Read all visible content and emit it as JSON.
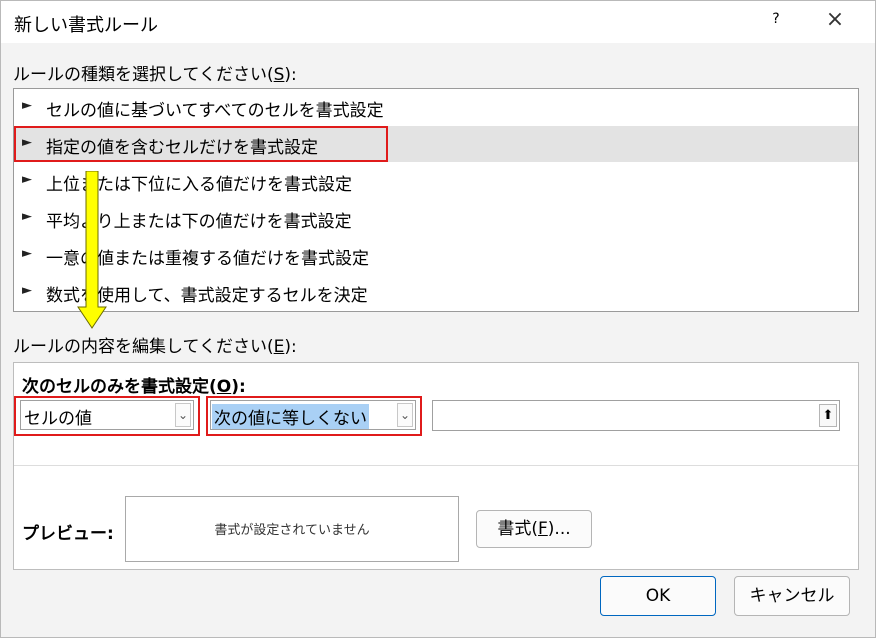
{
  "window": {
    "title": "新しい書式ルール",
    "help": "?",
    "close": "×"
  },
  "rule_type": {
    "label_pre": "ルールの種類を選択してください(",
    "label_key": "S",
    "label_post": "):",
    "items": [
      {
        "arrow": "►",
        "label": "セルの値に基づいてすべてのセルを書式設定"
      },
      {
        "arrow": "►",
        "label": "指定の値を含むセルだけを書式設定"
      },
      {
        "arrow": "►",
        "label": "上位または下位に入る値だけを書式設定"
      },
      {
        "arrow": "►",
        "label": "平均より上または下の値だけを書式設定"
      },
      {
        "arrow": "►",
        "label": "一意の値または重複する値だけを書式設定"
      },
      {
        "arrow": "►",
        "label": "数式を使用して、書式設定するセルを決定"
      }
    ],
    "selected_index": 1
  },
  "edit": {
    "label_pre": "ルールの内容を編集してください(",
    "label_key": "E",
    "label_post": "):",
    "heading_pre": "次のセルのみを書式設定(",
    "heading_key": "O",
    "heading_post": "):",
    "combo1_value": "セルの値",
    "combo2_value": "次の値に等しくない",
    "value_input": ""
  },
  "preview": {
    "label": "プレビュー:",
    "text": "書式が設定されていません",
    "format_button_pre": "書式(",
    "format_button_key": "F",
    "format_button_post": ")..."
  },
  "buttons": {
    "ok": "OK",
    "cancel": "キャンセル"
  },
  "colors": {
    "highlight_border": "#e01b1b",
    "arrow_fill": "#ffff00",
    "selected_row": "#e3e3e3",
    "selection_highlight": "#a9d0f5"
  }
}
